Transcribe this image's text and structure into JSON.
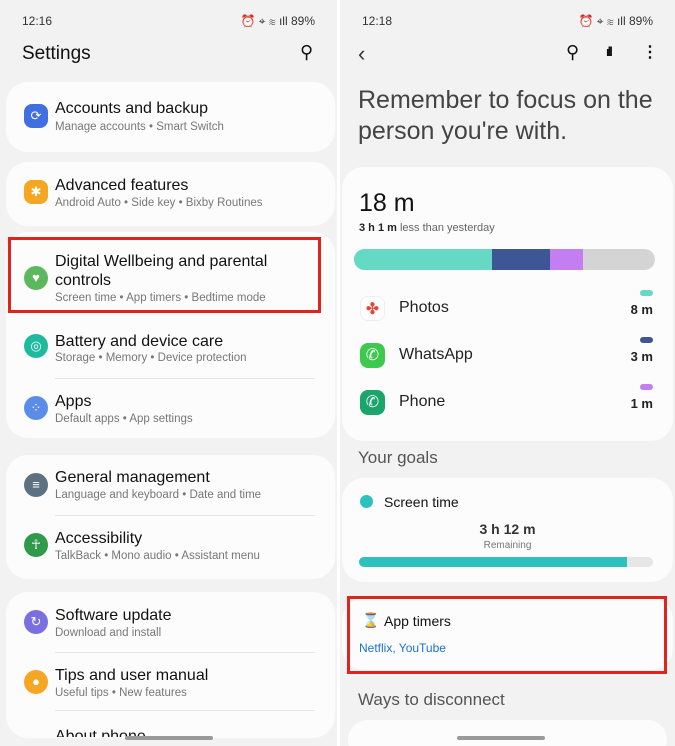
{
  "left": {
    "status": {
      "time": "12:16",
      "right": "⏰ ⌖ ≋ ıll 89%"
    },
    "title": "Settings",
    "items": [
      {
        "title": "Accounts and backup",
        "subtitle": "Manage accounts  •  Smart Switch",
        "icon": "sync-icon",
        "color": "#3f6fe0"
      },
      {
        "title": "Advanced features",
        "subtitle": "Android Auto  •  Side key  •  Bixby Routines",
        "icon": "gear-plus-icon",
        "color": "#f5a623"
      },
      {
        "title": "Digital Wellbeing and parental controls",
        "subtitle": "Screen time  •  App timers  •  Bedtime mode",
        "icon": "heart-circle-icon",
        "color": "#5cb85c"
      },
      {
        "title": "Battery and device care",
        "subtitle": "Storage  •  Memory  •  Device protection",
        "icon": "device-care-icon",
        "color": "#1fb9a0"
      },
      {
        "title": "Apps",
        "subtitle": "Default apps  •  App settings",
        "icon": "apps-grid-icon",
        "color": "#5b8de8"
      },
      {
        "title": "General management",
        "subtitle": "Language and keyboard  •  Date and time",
        "icon": "sliders-icon",
        "color": "#5c7182"
      },
      {
        "title": "Accessibility",
        "subtitle": "TalkBack  •  Mono audio  •  Assistant menu",
        "icon": "accessibility-icon",
        "color": "#2e9a4a"
      },
      {
        "title": "Software update",
        "subtitle": "Download and install",
        "icon": "update-icon",
        "color": "#7a6fe0"
      },
      {
        "title": "Tips and user manual",
        "subtitle": "Useful tips  •  New features",
        "icon": "bulb-icon",
        "color": "#f5a623"
      },
      {
        "title": "About phone",
        "subtitle": "",
        "icon": "",
        "color": ""
      }
    ]
  },
  "right": {
    "status": {
      "time": "12:18",
      "right": "⏰ ⌖ ≋ ıll 89%"
    },
    "headline": "Remember to focus on the person you're with.",
    "total": "18 m",
    "compare_bold": "3 h 1 m",
    "compare_rest": " less than yesterday",
    "usage_bar": [
      {
        "app": "Photos",
        "fraction": 0.46,
        "color": "#66d9c5"
      },
      {
        "app": "WhatsApp",
        "fraction": 0.19,
        "color": "#3d5796"
      },
      {
        "app": "Phone",
        "fraction": 0.11,
        "color": "#c37ef2"
      }
    ],
    "apps": [
      {
        "name": "Photos",
        "time": "8 m",
        "color": "#66d9c5",
        "icon": "google-photos-icon"
      },
      {
        "name": "WhatsApp",
        "time": "3 m",
        "color": "#3d5796",
        "icon": "whatsapp-icon"
      },
      {
        "name": "Phone",
        "time": "1 m",
        "color": "#c37ef2",
        "icon": "phone-icon"
      }
    ],
    "goals_header": "Your goals",
    "screen_time": {
      "label": "Screen time",
      "value": "3 h 12 m",
      "caption": "Remaining",
      "progress": 0.91,
      "color": "#2ebfbf"
    },
    "app_timers": {
      "label": "App timers",
      "apps": "Netflix, YouTube",
      "link_color": "#1a73c8"
    },
    "disconnect_header": "Ways to disconnect"
  }
}
